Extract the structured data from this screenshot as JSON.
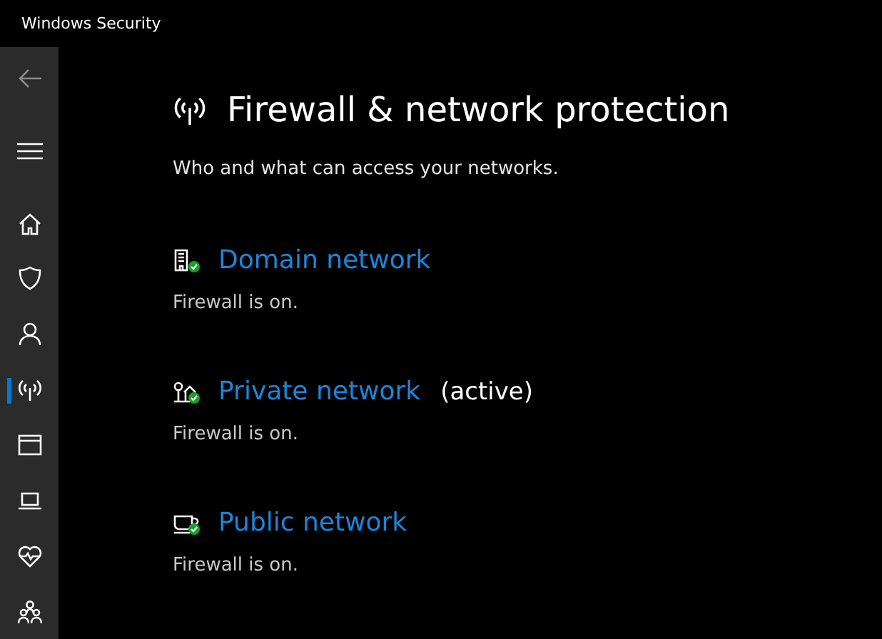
{
  "window": {
    "title": "Windows Security"
  },
  "sidebar": {
    "items": [
      {
        "kind": "home",
        "selected": false
      },
      {
        "kind": "shield",
        "selected": false
      },
      {
        "kind": "person",
        "selected": false
      },
      {
        "kind": "antenna",
        "selected": true
      },
      {
        "kind": "browser",
        "selected": false
      },
      {
        "kind": "laptop",
        "selected": false
      },
      {
        "kind": "heart",
        "selected": false
      },
      {
        "kind": "family",
        "selected": false
      }
    ]
  },
  "page": {
    "title": "Firewall & network protection",
    "subtitle": "Who and what can access your networks."
  },
  "networks": [
    {
      "kind": "domain",
      "name": "Domain network",
      "status": "Firewall is on."
    },
    {
      "kind": "private",
      "name": "Private network",
      "note": "(active)",
      "status": "Firewall is on."
    },
    {
      "kind": "public",
      "name": "Public network",
      "status": "Firewall is on."
    }
  ]
}
